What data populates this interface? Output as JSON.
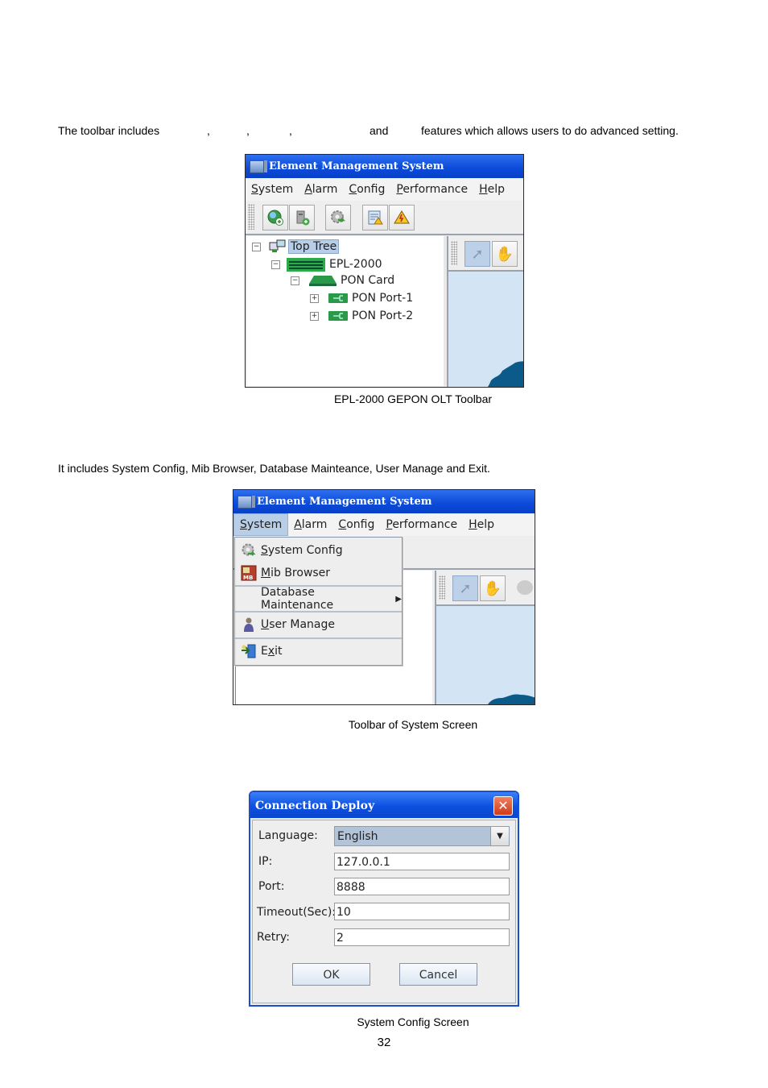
{
  "intro_text": {
    "part1": "The toolbar includes",
    "sep1": ",",
    "sep2": ",",
    "sep3": ",",
    "and": "and",
    "part2": "features which allows users to do advanced setting."
  },
  "figure1": {
    "window_title": "Element Management System",
    "menu": [
      "System",
      "Alarm",
      "Config",
      "Performance",
      "Help"
    ],
    "toolbar_icons": [
      "add-site-icon",
      "add-device-icon",
      "config-gear-icon",
      "alarm-report-icon",
      "alarm-warning-icon"
    ],
    "tree": [
      {
        "label": "Top Tree",
        "expander": "−",
        "selected": true
      },
      {
        "label": "EPL-2000",
        "expander": "−"
      },
      {
        "label": "PON Card",
        "expander": "−"
      },
      {
        "label": "PON Port-1",
        "expander": "+"
      },
      {
        "label": "PON Port-2",
        "expander": "+"
      }
    ],
    "map_tools": [
      "select-arrow-icon",
      "hand-pan-icon"
    ],
    "caption": "EPL-2000 GEPON OLT Toolbar"
  },
  "system_text": "It includes System Config, Mib Browser, Database Mainteance, User Manage and Exit.",
  "figure2": {
    "window_title": "Element Management System",
    "menu": [
      "System",
      "Alarm",
      "Config",
      "Performance",
      "Help"
    ],
    "active_menu": "System",
    "dropdown": [
      {
        "label": "System Config",
        "icon": "gear-config-icon",
        "mnemonic": "S"
      },
      {
        "label": "Mib Browser",
        "icon": "mib-browser-icon",
        "mnemonic": "M"
      },
      {
        "label": "Database  Maintenance",
        "icon": "",
        "submenu": true
      },
      {
        "label": "User Manage",
        "icon": "user-icon",
        "mnemonic": "U"
      },
      {
        "label": "Exit",
        "icon": "exit-door-icon",
        "mnemonic": "x"
      }
    ],
    "caption": "Toolbar of System Screen"
  },
  "figure3": {
    "dialog_title": "Connection Deploy",
    "fields": [
      {
        "label": "Language:",
        "value": "English",
        "type": "combo"
      },
      {
        "label": "IP:",
        "value": "127.0.0.1",
        "type": "text"
      },
      {
        "label": "Port:",
        "value": "8888",
        "type": "text"
      },
      {
        "label": "Timeout(Sec):",
        "value": "10",
        "type": "text"
      },
      {
        "label": "Retry:",
        "value": "2",
        "type": "text"
      }
    ],
    "ok_label": "OK",
    "cancel_label": "Cancel",
    "caption": "System Config Screen"
  },
  "page_number": "32"
}
